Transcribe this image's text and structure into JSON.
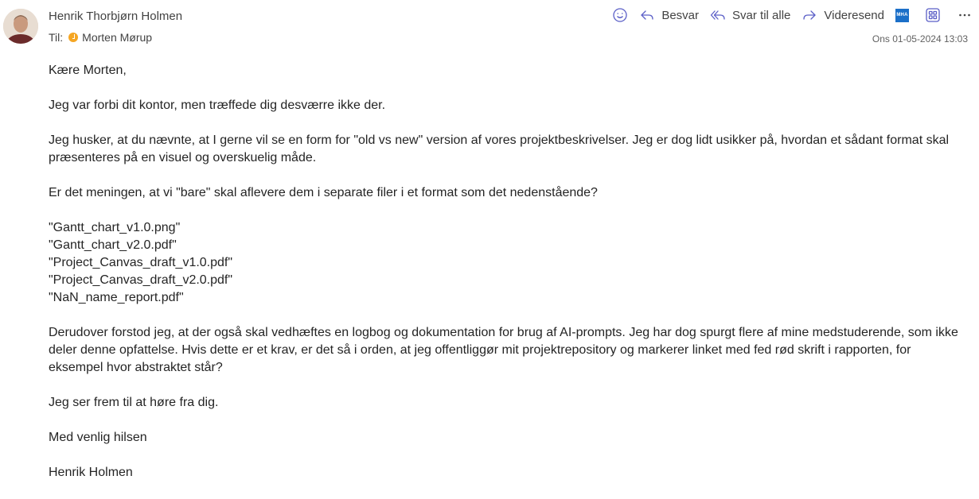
{
  "header": {
    "sender_name": "Henrik Thorbjørn Holmen",
    "to_label": "Til:",
    "recipient": "Morten Mørup",
    "date": "Ons 01-05-2024 13:03"
  },
  "toolbar": {
    "emoji_icon": "smiley-icon",
    "reply_label": "Besvar",
    "reply_all_label": "Svar til alle",
    "forward_label": "Videresend",
    "mha_label": "MHA",
    "apps_icon": "apps-icon",
    "more_icon": "more-icon"
  },
  "body": {
    "greeting": "Kære Morten,",
    "p1": "Jeg var forbi dit kontor, men træffede dig desværre ikke der.",
    "p2": "Jeg husker, at du nævnte, at I gerne vil se en form for \"old vs new\" version af vores projektbeskrivelser. Jeg er dog lidt usikker på, hvordan et sådant format skal præsenteres på en visuel og overskuelig måde.",
    "p3": "Er det meningen, at vi \"bare\" skal aflevere dem i separate filer i et format som det nedenstående?",
    "files": [
      "\"Gantt_chart_v1.0.png\"",
      "\"Gantt_chart_v2.0.pdf\"",
      "\"Project_Canvas_draft_v1.0.pdf\"",
      "\"Project_Canvas_draft_v2.0.pdf\"",
      "\"NaN_name_report.pdf\""
    ],
    "p4": "Derudover forstod jeg, at der også skal vedhæftes en logbog og dokumentation for brug af AI-prompts. Jeg har dog spurgt flere af mine medstuderende, som ikke deler denne opfattelse. Hvis dette er et krav, er det så i orden, at jeg offentliggør mit projektrepository og markerer linket med fed rød skrift i rapporten, for eksempel hvor abstraktet står?",
    "p5": "Jeg ser frem til at høre fra dig.",
    "closing": "Med venlig hilsen",
    "signature": "Henrik Holmen"
  },
  "colors": {
    "accent": "#5b5fc7",
    "presence_away": "#f5a623",
    "mha_blue": "#1b6fc8"
  }
}
